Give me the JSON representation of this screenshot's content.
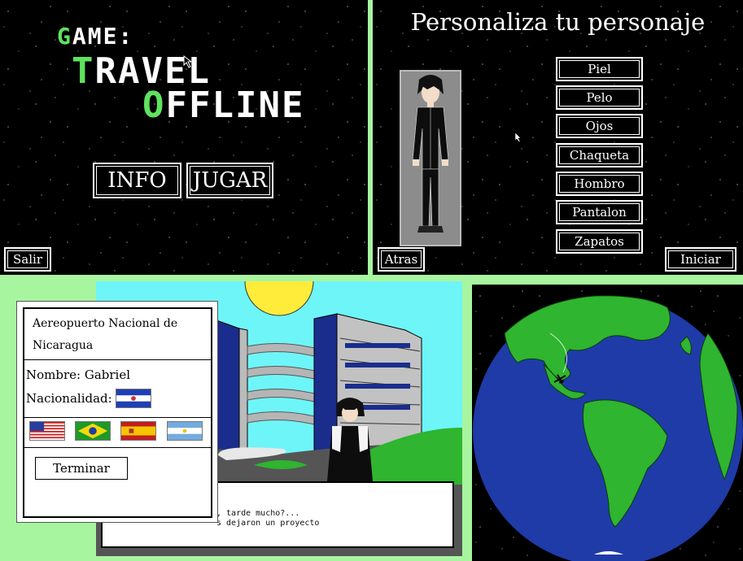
{
  "menu": {
    "title_line1": "GAME:",
    "title_line2": "TRAVEL",
    "title_line3": "OFFLINE",
    "info_label": "INFO",
    "play_label": "JUGAR",
    "exit_label": "Salir"
  },
  "customize": {
    "title": "Personaliza tu personaje",
    "options": [
      "Piel",
      "Pelo",
      "Ojos",
      "Chaqueta",
      "Hombro",
      "Pantalon",
      "Zapatos"
    ],
    "back_label": "Atras",
    "start_label": "Iniciar"
  },
  "scene": {
    "dialog_line1": ", tarde mucho?...",
    "dialog_line2": "s dejaron un proyecto"
  },
  "passport": {
    "title_line1": "Aereopuerto Nacional de",
    "title_line2": "Nicaragua",
    "name_text": "Nombre: Gabriel",
    "nationality_text": "Nacionalidad:",
    "flags": [
      "usa-flag-icon",
      "brazil-flag-icon",
      "spain-flag-icon",
      "argentina-flag-icon"
    ],
    "finish_label": "Terminar"
  },
  "colors": {
    "accent_green": "#5fe35f",
    "background": "#a8f5a0",
    "ocean": "#1f3ba8",
    "land": "#2fb52f"
  }
}
